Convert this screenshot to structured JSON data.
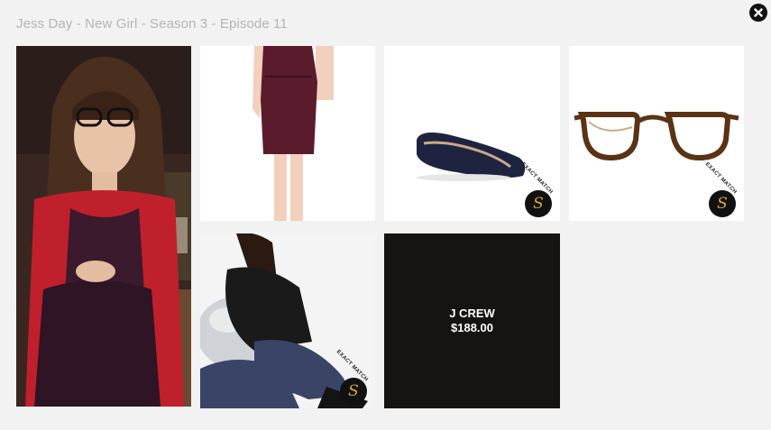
{
  "header": {
    "title": "Jess Day - New Girl - Season 3 - Episode 11",
    "close_icon": "close-icon"
  },
  "tiles": {
    "scene": {
      "icon": "scene-photo"
    },
    "dress": {
      "icon": "dress-photo"
    },
    "flats": {
      "icon": "flats-photo",
      "badge": {
        "label": "EXACT MATCH",
        "logo": "S"
      }
    },
    "glasses": {
      "icon": "glasses-photo",
      "badge": {
        "label": "EXACT MATCH",
        "logo": "S"
      }
    },
    "tights": {
      "icon": "tights-photo",
      "badge": {
        "label": "EXACT MATCH",
        "logo": "S"
      }
    },
    "price_card": {
      "brand": "J CREW",
      "price": "$188.00"
    }
  },
  "colors": {
    "background": "#f2f2f2",
    "title": "#b5b5b5",
    "price_card": "#161412",
    "badge_logo": "#d9a83a"
  }
}
